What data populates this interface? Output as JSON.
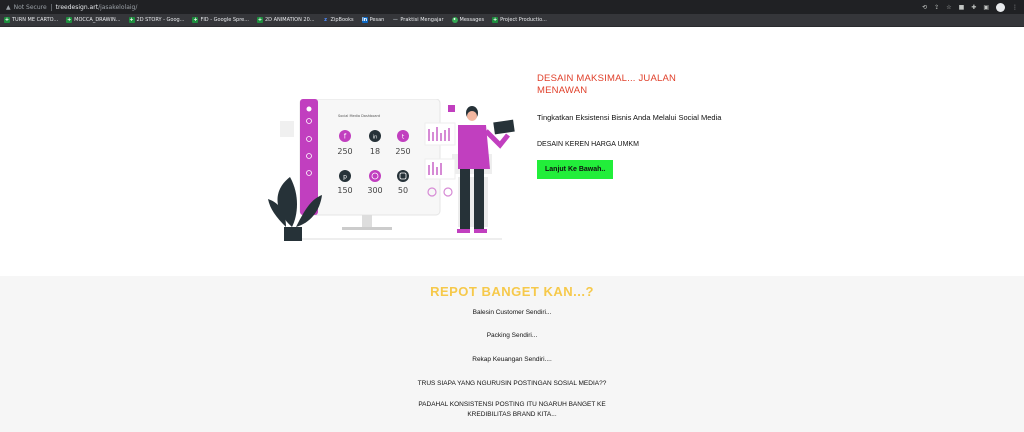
{
  "browser": {
    "security_label": "Not Secure",
    "url_host": "treedesign.art",
    "url_path": "/jasakelolaig/"
  },
  "bookmarks": [
    {
      "label": "TURN ME CARTO...",
      "icon": "google-sheets-icon"
    },
    {
      "label": "MOCCA_DRAWIN...",
      "icon": "google-sheets-icon"
    },
    {
      "label": "2D STORY - Goog...",
      "icon": "google-sheets-icon"
    },
    {
      "label": "FID - Google Spre...",
      "icon": "google-sheets-icon"
    },
    {
      "label": "2D ANIMATION 20...",
      "icon": "google-sheets-icon"
    },
    {
      "label": "ZipBooks",
      "icon": "zipbooks-icon"
    },
    {
      "label": "Pesan",
      "icon": "linkedin-icon"
    },
    {
      "label": "Praktisi Mengajar",
      "icon": "praktisi-icon"
    },
    {
      "label": "Messages",
      "icon": "messages-icon"
    },
    {
      "label": "Project Productio...",
      "icon": "google-sheets-icon"
    }
  ],
  "hero": {
    "title": "DESAIN MAKSIMAL... JUALAN MENAWAN",
    "subtitle": "Tingkatkan Eksistensi Bisnis Anda Melalui Social Media",
    "tagline": "DESAIN KEREN HARGA UMKM",
    "cta_label": "Lanjut Ke Bawah.."
  },
  "illustration": {
    "dashboard_title": "Social Media Dashboard",
    "stats": [
      {
        "platform": "facebook",
        "value": "250",
        "color": "#c13fbf"
      },
      {
        "platform": "linkedin",
        "value": "18",
        "color": "#263238"
      },
      {
        "platform": "twitter",
        "value": "250",
        "color": "#c13fbf"
      },
      {
        "platform": "pinterest",
        "value": "150",
        "color": "#263238"
      },
      {
        "platform": "dribbble",
        "value": "300",
        "color": "#c13fbf"
      },
      {
        "platform": "instagram",
        "value": "50",
        "color": "#263238"
      }
    ]
  },
  "section2": {
    "title": "REPOT BANGET KAN...?",
    "lines": [
      "Balesin Customer Sendiri...",
      "Packing Sendiri...",
      "Rekap Keuangan Sendiri....",
      "TRUS SIAPA YANG NGURUSIN POSTINGAN SOSIAL MEDIA??",
      "PADAHAL KONSISTENSI POSTING ITU NGARUH BANGET KE KREDIBILITAS BRAND KITA..."
    ]
  },
  "colors": {
    "accent_red": "#e0402b",
    "cta_green": "#22ee3a",
    "title_yellow": "#f6c94b",
    "brand_magenta": "#c13fbf"
  }
}
